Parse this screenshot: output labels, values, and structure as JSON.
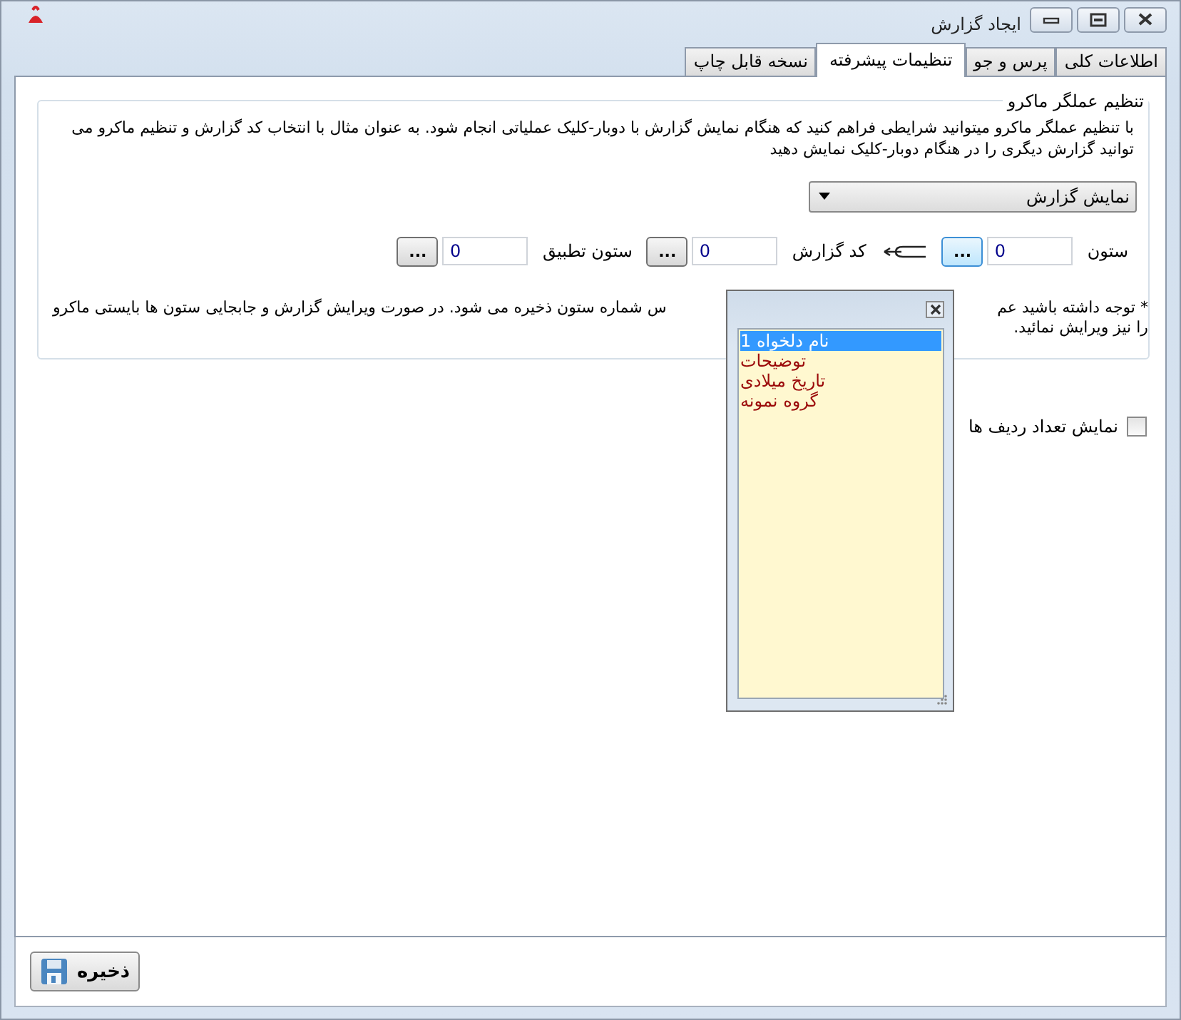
{
  "window": {
    "title": "ایجاد گزارش"
  },
  "tabs": [
    {
      "label": "اطلاعات کلی",
      "selected": false
    },
    {
      "label": "پرس و جو",
      "selected": false
    },
    {
      "label": "تنظیمات پیشرفته",
      "selected": true
    },
    {
      "label": "نسخه قابل چاپ",
      "selected": false
    }
  ],
  "macro_group": {
    "title": "تنظیم عملگر ماکرو",
    "description": "با تنظیم عملگر ماکرو میتوانید شرایطی فراهم کنید که هنگام نمایش گزارش با دوبار-کلیک عملیاتی انجام شود. به عنوان مثال با انتخاب کد گزارش و تنظیم ماکرو می توانید گزارش دیگری را در هنگام دوبار-کلیک نمایش دهید",
    "action_dropdown": {
      "value": "نمایش گزارش"
    },
    "fields": [
      {
        "label": "ستون",
        "value": "0",
        "button": "...",
        "focused": true
      },
      {
        "label": "کد گزارش",
        "value": "0",
        "button": "...",
        "focused": false
      },
      {
        "label": "ستون تطبیق",
        "value": "0",
        "button": "...",
        "focused": false
      }
    ],
    "note": {
      "line_1_right": "* توجه داشته باشید عم",
      "line_1_left": "س شماره ستون ذخیره می شود. در صورت ویرایش گزارش و جابجایی ستون ها بایستی ماکرو",
      "line_2": "را نیز ویرایش نمائید."
    }
  },
  "show_row_count": {
    "label": "نمایش تعداد ردیف ها",
    "checked": false
  },
  "column_popup": {
    "items": [
      {
        "label": "نام دلخواه 1",
        "selected": true
      },
      {
        "label": "توضیحات",
        "selected": false
      },
      {
        "label": "تاریخ میلادی",
        "selected": false
      },
      {
        "label": "گروه نمونه",
        "selected": false
      }
    ]
  },
  "save_button": {
    "label": "ذخیره"
  }
}
